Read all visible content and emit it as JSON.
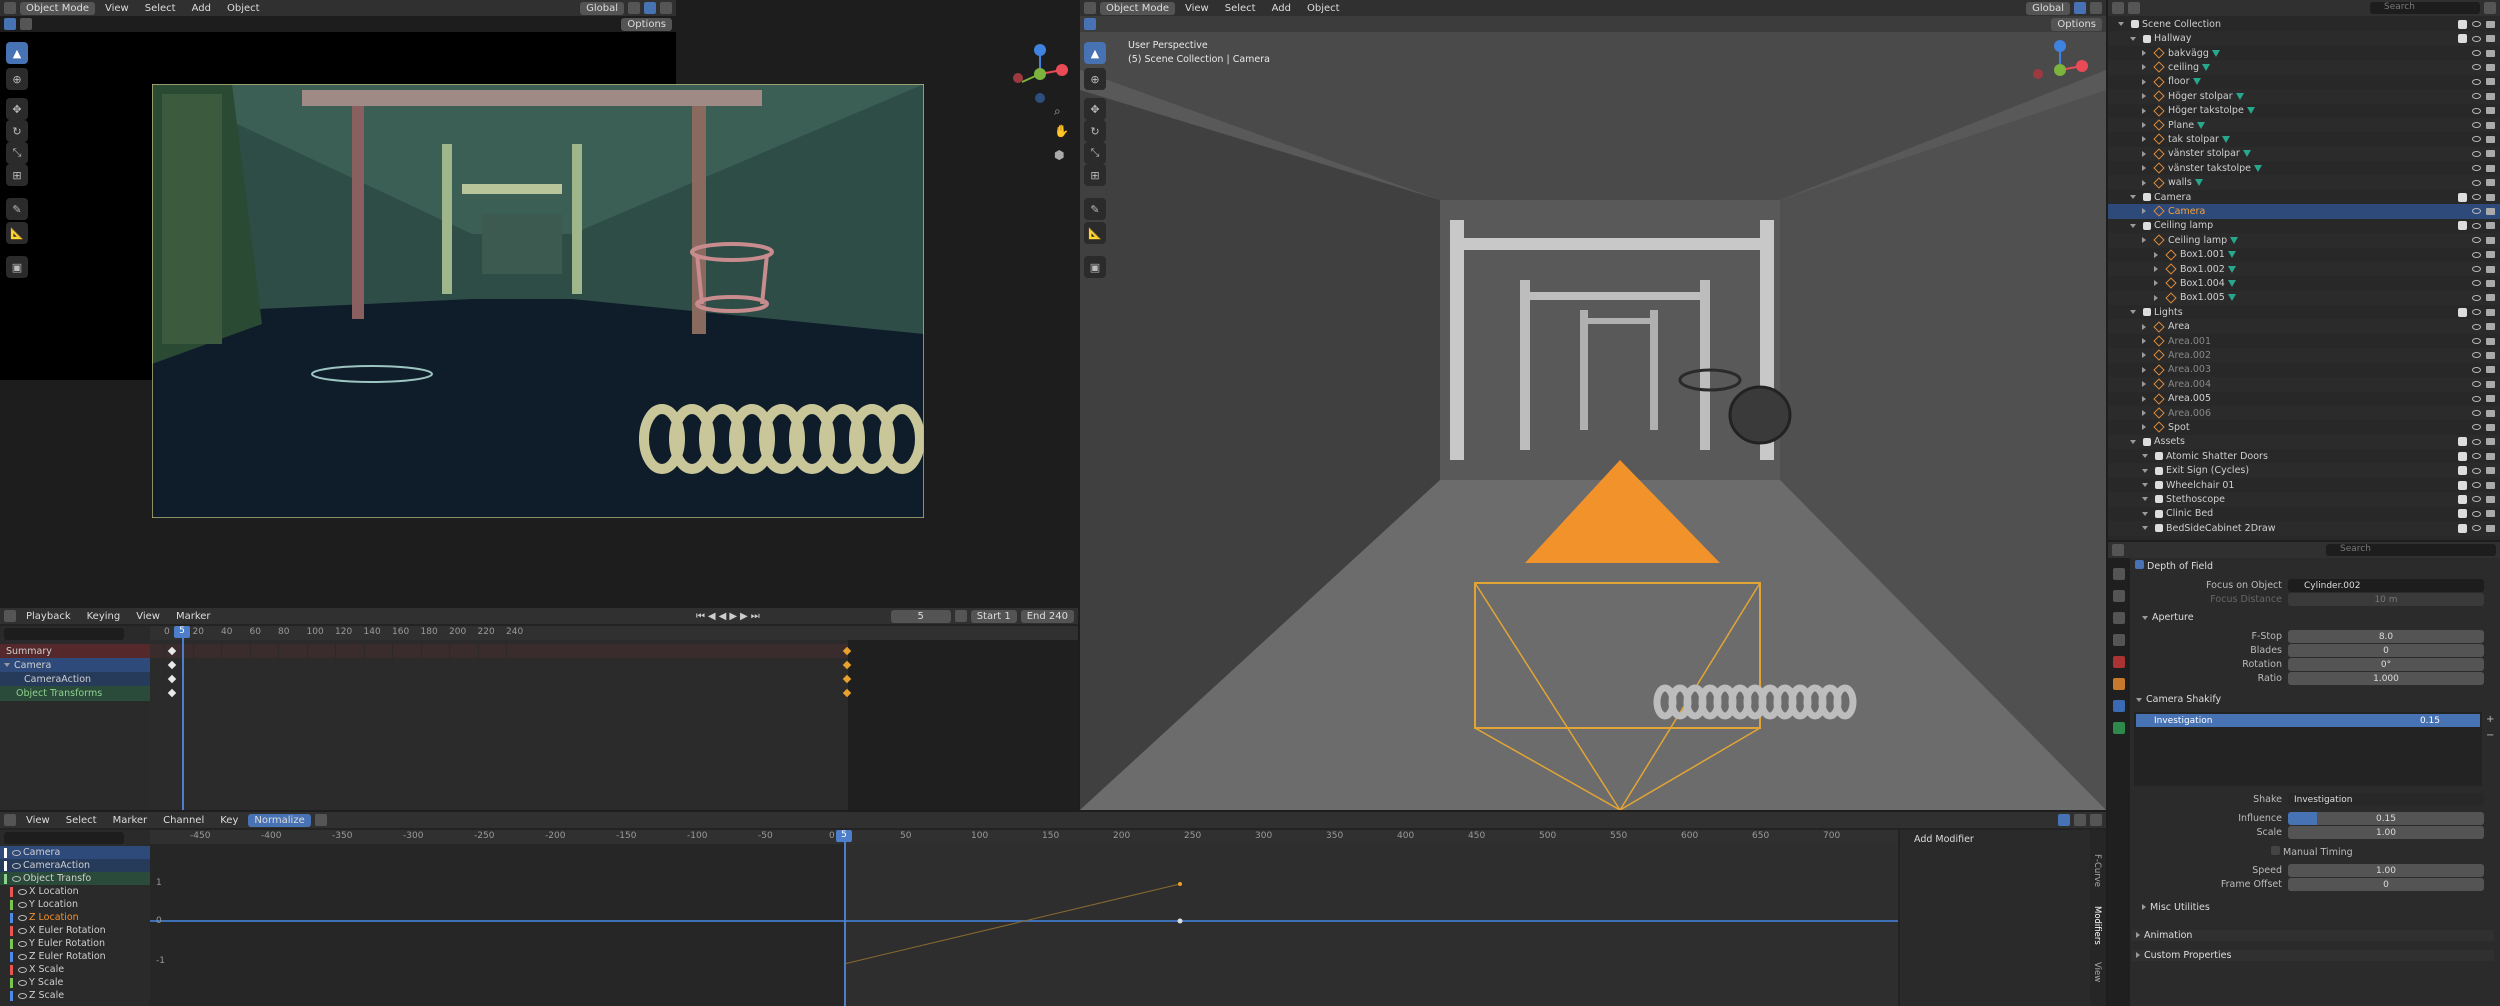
{
  "left_viewport": {
    "mode": "Object Mode",
    "menus": [
      "View",
      "Select",
      "Add",
      "Object"
    ],
    "transform": "Global",
    "options": "Options"
  },
  "right_viewport": {
    "mode": "Object Mode",
    "menus": [
      "View",
      "Select",
      "Add",
      "Object"
    ],
    "transform": "Global",
    "options": "Options",
    "overlay_line1": "User Perspective",
    "overlay_line2": "(5) Scene Collection | Camera"
  },
  "timeline": {
    "menus": [
      "Playback",
      "Keying",
      "View",
      "Marker"
    ],
    "current_frame": "5",
    "start_label": "Start",
    "start": "1",
    "end_label": "End",
    "end": "240",
    "ticks": [
      "0",
      "20",
      "40",
      "60",
      "80",
      "100",
      "120",
      "140",
      "160",
      "180",
      "200",
      "220",
      "240"
    ],
    "channels": [
      "Summary",
      "Camera",
      "CameraAction",
      "Object Transforms"
    ]
  },
  "graph_editor": {
    "menus": [
      "View",
      "Select",
      "Marker",
      "Channel",
      "Key"
    ],
    "normalize": "Normalize",
    "current_frame": "5",
    "ticks": [
      "-450",
      "-400",
      "-350",
      "-300",
      "-250",
      "-200",
      "-150",
      "-100",
      "-50",
      "0",
      "50",
      "100",
      "150",
      "200",
      "250",
      "300",
      "350",
      "400",
      "450",
      "500",
      "550",
      "600",
      "650",
      "700"
    ],
    "yticks": [
      "1",
      "0",
      "-1"
    ],
    "channels": [
      "Camera",
      "CameraAction",
      "Object Transfo",
      "X Location",
      "Y Location",
      "Z Location",
      "X Euler Rotation",
      "Y Euler Rotation",
      "Z Euler Rotation",
      "X Scale",
      "Y Scale",
      "Z Scale"
    ],
    "add_modifier": "Add Modifier",
    "side_tabs": [
      "F-Curve",
      "Modifiers",
      "View"
    ]
  },
  "outliner": {
    "search_placeholder": "Search",
    "items": [
      {
        "name": "Scene Collection",
        "lvl": 0,
        "kind": "col"
      },
      {
        "name": "Hallway",
        "lvl": 1,
        "kind": "col"
      },
      {
        "name": "bakvägg",
        "lvl": 2,
        "kind": "obj"
      },
      {
        "name": "ceiling",
        "lvl": 2,
        "kind": "obj"
      },
      {
        "name": "floor",
        "lvl": 2,
        "kind": "obj"
      },
      {
        "name": "Höger stolpar",
        "lvl": 2,
        "kind": "obj"
      },
      {
        "name": "Höger takstolpe",
        "lvl": 2,
        "kind": "obj"
      },
      {
        "name": "Plane",
        "lvl": 2,
        "kind": "obj"
      },
      {
        "name": "tak stolpar",
        "lvl": 2,
        "kind": "obj"
      },
      {
        "name": "vänster stolpar",
        "lvl": 2,
        "kind": "obj"
      },
      {
        "name": "vänster takstolpe",
        "lvl": 2,
        "kind": "obj"
      },
      {
        "name": "walls",
        "lvl": 2,
        "kind": "obj"
      },
      {
        "name": "Camera",
        "lvl": 1,
        "kind": "col"
      },
      {
        "name": "Camera",
        "lvl": 2,
        "kind": "cam"
      },
      {
        "name": "Ceiling lamp",
        "lvl": 1,
        "kind": "col"
      },
      {
        "name": "Ceiling lamp",
        "lvl": 2,
        "kind": "obj"
      },
      {
        "name": "Box1.001",
        "lvl": 3,
        "kind": "obj"
      },
      {
        "name": "Box1.002",
        "lvl": 3,
        "kind": "obj"
      },
      {
        "name": "Box1.004",
        "lvl": 3,
        "kind": "obj"
      },
      {
        "name": "Box1.005",
        "lvl": 3,
        "kind": "obj"
      },
      {
        "name": "Lights",
        "lvl": 1,
        "kind": "col"
      },
      {
        "name": "Area",
        "lvl": 2,
        "kind": "light"
      },
      {
        "name": "Area.001",
        "lvl": 2,
        "kind": "light"
      },
      {
        "name": "Area.002",
        "lvl": 2,
        "kind": "light"
      },
      {
        "name": "Area.003",
        "lvl": 2,
        "kind": "light"
      },
      {
        "name": "Area.004",
        "lvl": 2,
        "kind": "light"
      },
      {
        "name": "Area.005",
        "lvl": 2,
        "kind": "light"
      },
      {
        "name": "Area.006",
        "lvl": 2,
        "kind": "light"
      },
      {
        "name": "Spot",
        "lvl": 2,
        "kind": "light"
      },
      {
        "name": "Assets",
        "lvl": 1,
        "kind": "col"
      },
      {
        "name": "Atomic Shatter Doors",
        "lvl": 2,
        "kind": "col"
      },
      {
        "name": "Exit Sign (Cycles)",
        "lvl": 2,
        "kind": "col"
      },
      {
        "name": "Wheelchair 01",
        "lvl": 2,
        "kind": "col"
      },
      {
        "name": "Stethoscope",
        "lvl": 2,
        "kind": "col"
      },
      {
        "name": "Clinic Bed",
        "lvl": 2,
        "kind": "col"
      },
      {
        "name": "BedSideCabinet 2Draw",
        "lvl": 2,
        "kind": "col"
      }
    ]
  },
  "properties": {
    "search_placeholder": "Search",
    "dof": {
      "title": "Depth of Field",
      "focus_object_label": "Focus on Object",
      "focus_object": "Cylinder.002",
      "focus_distance_label": "Focus Distance",
      "focus_distance": "10 m"
    },
    "aperture": {
      "title": "Aperture",
      "fstop_label": "F-Stop",
      "fstop": "8.0",
      "blades_label": "Blades",
      "blades": "0",
      "rotation_label": "Rotation",
      "rotation": "0°",
      "ratio_label": "Ratio",
      "ratio": "1.000"
    },
    "shakify": {
      "title": "Camera Shakify",
      "list_item": "Investigation",
      "list_value": "0.15",
      "shake_label": "Shake",
      "shake": "Investigation",
      "influence_label": "Influence",
      "influence": "0.15",
      "influence_fraction": 0.15,
      "scale_label": "Scale",
      "scale": "1.00",
      "manual_timing": "Manual Timing",
      "speed_label": "Speed",
      "speed": "1.00",
      "frame_offset_label": "Frame Offset",
      "frame_offset": "0"
    },
    "misc": "Misc Utilities",
    "animation": "Animation",
    "custom_properties": "Custom Properties"
  },
  "colors": {
    "accent": "#4772b3",
    "orange": "#f2922a",
    "selected_row": "#2e4a7a"
  }
}
